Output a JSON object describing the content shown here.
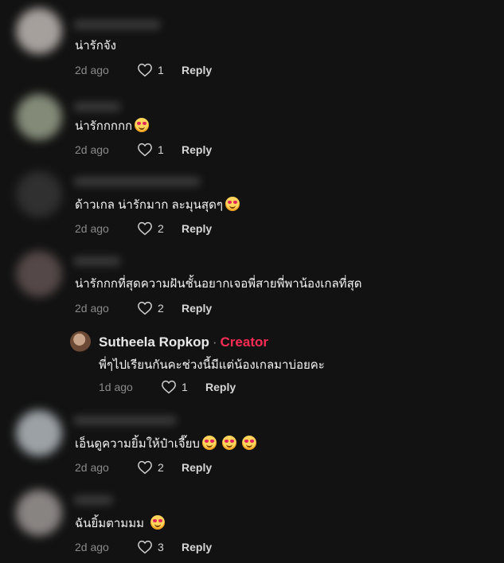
{
  "comments": [
    {
      "text": "น่ารักจัง",
      "emoji": 0,
      "date": "2d ago",
      "likes": "1",
      "reply": "Reply"
    },
    {
      "text": "น่ารักกกกก",
      "emoji": 1,
      "date": "2d ago",
      "likes": "1",
      "reply": "Reply"
    },
    {
      "text": "ด้าวเกล น่ารักมาก ละมุนสุดๆ",
      "emoji": 1,
      "date": "2d ago",
      "likes": "2",
      "reply": "Reply"
    },
    {
      "text": "น่ารักกกที่สุดความฝันชั้นอยากเจอพี่สายพี่พาน้องเกลที่สุด",
      "emoji": 0,
      "date": "2d ago",
      "likes": "2",
      "reply": "Reply"
    },
    {
      "text": "เอ็นดูความยิ้มให้ป๋าเจี๊ยบ",
      "emoji": 3,
      "date": "2d ago",
      "likes": "2",
      "reply": "Reply"
    },
    {
      "text": "ฉันยิ้มตามมม",
      "emoji": 1,
      "date": "2d ago",
      "likes": "3",
      "reply": "Reply"
    }
  ],
  "creator_reply": {
    "name": "Sutheela Ropkop",
    "separator": "·",
    "badge": "Creator",
    "text": "พี่ๆไปเรียนกันคะช่วงนี้มีแต่น้องเกลมาบ่อยคะ",
    "date": "1d ago",
    "likes": "1",
    "reply": "Reply"
  },
  "colors": {
    "background": "#121212",
    "creator_badge": "#fe2c55",
    "meta": "#8a8a8a"
  },
  "icons": {
    "like": "heart-outline-icon",
    "emoji": "smiling-face-with-heart-eyes-emoji"
  }
}
